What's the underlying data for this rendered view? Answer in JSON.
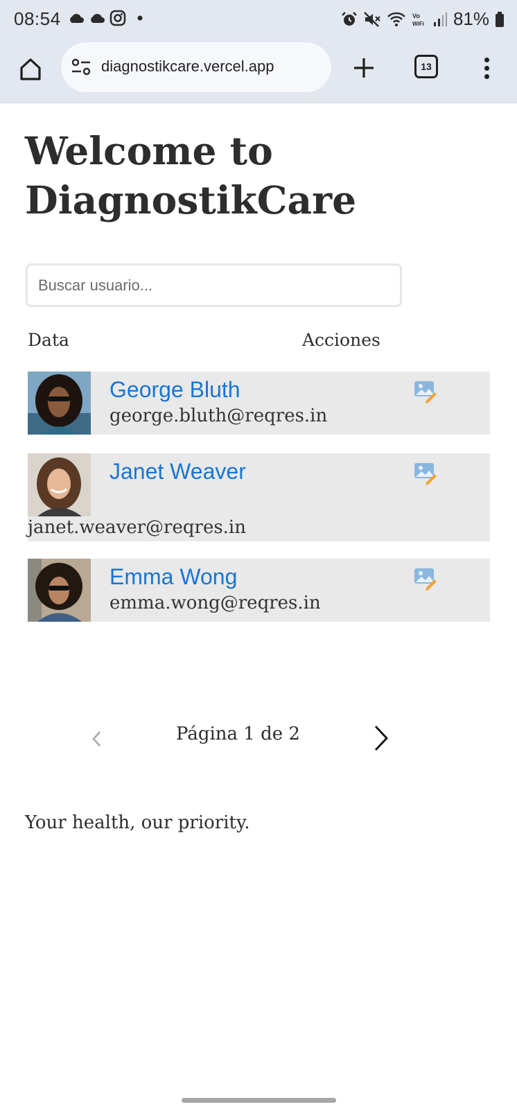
{
  "status_bar": {
    "time": "08:54",
    "battery": "81%",
    "left_icons": [
      "cloud-icon",
      "cloud-icon",
      "instagram-icon",
      "dot-icon"
    ],
    "right_icons": [
      "alarm-icon",
      "mute-icon",
      "wifi-icon",
      "vowifi-icon",
      "signal-icon",
      "battery-icon"
    ]
  },
  "browser": {
    "url": "diagnostikcare.vercel.app",
    "tab_count": "13"
  },
  "page": {
    "title": "Welcome to DiagnostikCare",
    "search_placeholder": "Buscar usuario...",
    "columns": {
      "data": "Data",
      "actions": "Acciones"
    },
    "users": [
      {
        "name": "George Bluth",
        "email": "george.bluth@reqres.in"
      },
      {
        "name": "Janet Weaver",
        "email": "janet.weaver@reqres.in"
      },
      {
        "name": "Emma Wong",
        "email": "emma.wong@reqres.in"
      }
    ],
    "pagination": {
      "label": "Página 1 de 2"
    },
    "footer": "Your health, our priority."
  },
  "colors": {
    "link": "#1976d2",
    "row_background": "#e9e9e9",
    "chrome_background": "#e2e7f0"
  }
}
